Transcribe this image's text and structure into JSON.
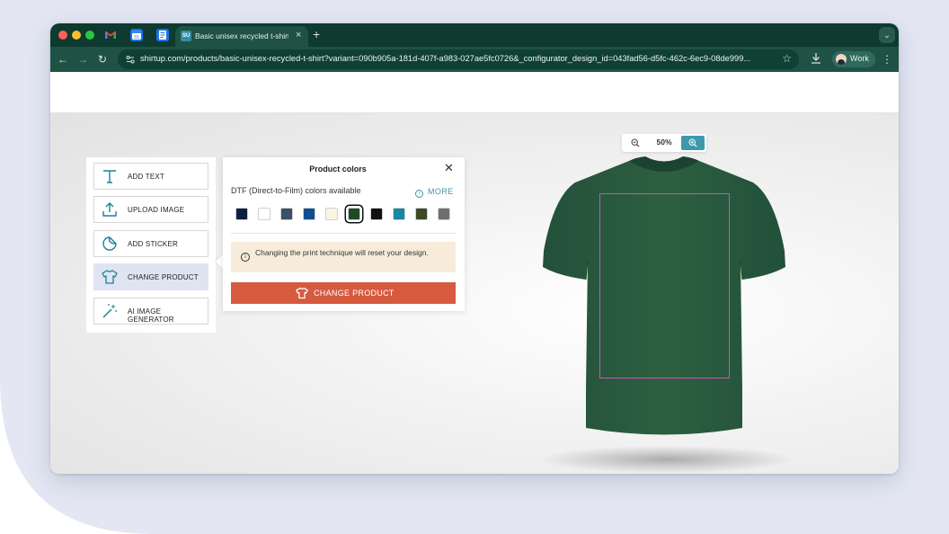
{
  "browser": {
    "active_tab_title": "Basic unisex recycled t-shirt",
    "active_tab_favicon": "SU",
    "new_tab_label": "+",
    "url": "shirtup.com/products/basic-unisex-recycled-t-shirt?variant=090b905a-181d-407f-a983-027ae5fc0726&_configurator_design_id=043fad56-d5fc-462c-6ec9-08de999...",
    "profile_label": "Work",
    "pinned_tabs": [
      "gmail-icon",
      "calendar-icon",
      "forms-icon"
    ]
  },
  "zoom": {
    "level": "50%",
    "zoom_out_icon": "zoom-out-icon",
    "zoom_in_icon": "zoom-in-icon"
  },
  "tools": [
    {
      "label": "ADD TEXT",
      "icon": "text-icon"
    },
    {
      "label": "UPLOAD IMAGE",
      "icon": "upload-icon"
    },
    {
      "label": "ADD STICKER",
      "icon": "sticker-icon"
    },
    {
      "label": "CHANGE PRODUCT",
      "icon": "tshirt-icon",
      "active": true
    },
    {
      "label": "AI IMAGE GENERATOR",
      "icon": "magic-wand-icon"
    }
  ],
  "panel": {
    "title": "Product colors",
    "technique_label": "DTF (Direct-to-Film) colors available",
    "more_label": "MORE",
    "swatches": [
      "#0f1f44",
      "#ffffff",
      "#3c4f66",
      "#104f8f",
      "#fbf6e4",
      "#1f4a26",
      "#111111",
      "#1887a5",
      "#3b4a25",
      "#6e6e72"
    ],
    "selected_swatch_index": 5,
    "notice": "Changing the print technique will reset your design.",
    "button_label": "CHANGE PRODUCT"
  },
  "colors": {
    "accent": "#3f98ad",
    "button": "#d55a3f",
    "shirt": "#2b5b3c",
    "print_area": "#c45ab3",
    "notice_bg": "#f7ecd9"
  }
}
